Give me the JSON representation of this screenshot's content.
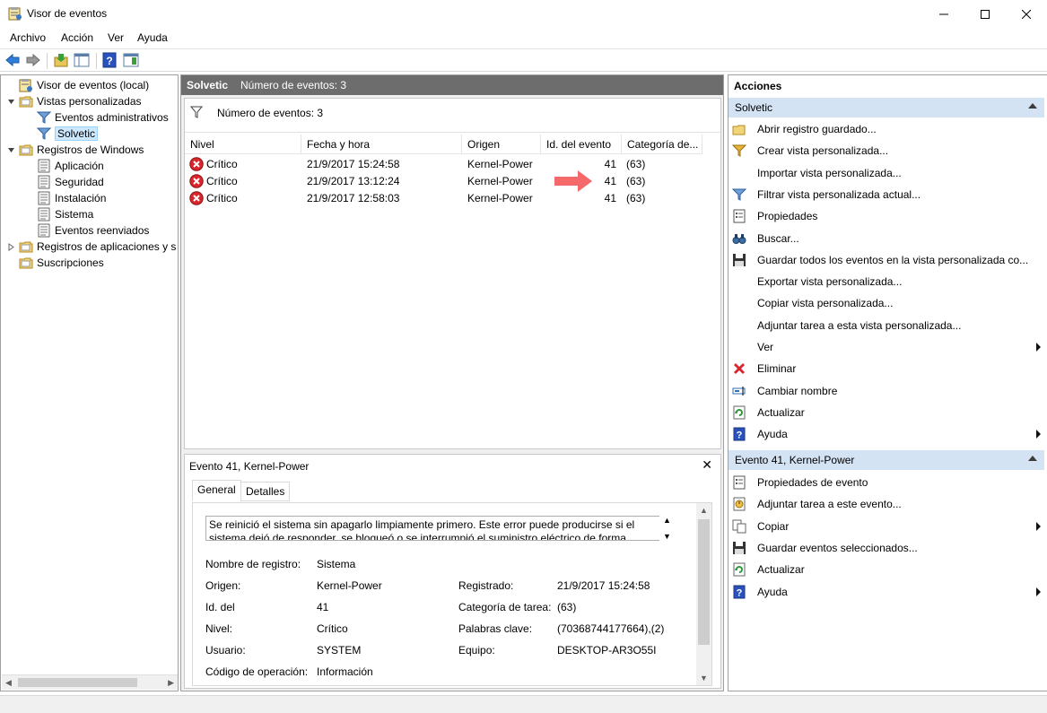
{
  "window": {
    "title": "Visor de eventos"
  },
  "menu": [
    "Archivo",
    "Acción",
    "Ver",
    "Ayuda"
  ],
  "toolbar": [
    "back-icon",
    "forward-icon",
    "open-folder-icon",
    "console-tree-icon",
    "help-icon",
    "action-pane-icon"
  ],
  "tree": [
    {
      "label": "Visor de eventos (local)",
      "icon": "event-viewer-icon",
      "level": 0,
      "twisty": ""
    },
    {
      "label": "Vistas personalizadas",
      "icon": "folder-icon",
      "level": 0,
      "twisty": "open"
    },
    {
      "label": "Eventos administrativos",
      "icon": "filter-icon",
      "level": 1,
      "twisty": ""
    },
    {
      "label": "Solvetic",
      "icon": "filter-icon",
      "level": 1,
      "twisty": "",
      "selected": true
    },
    {
      "label": "Registros de Windows",
      "icon": "folder-icon",
      "level": 0,
      "twisty": "open"
    },
    {
      "label": "Aplicación",
      "icon": "log-icon",
      "level": 1,
      "twisty": ""
    },
    {
      "label": "Seguridad",
      "icon": "log-icon",
      "level": 1,
      "twisty": ""
    },
    {
      "label": "Instalación",
      "icon": "log-icon",
      "level": 1,
      "twisty": ""
    },
    {
      "label": "Sistema",
      "icon": "log-icon",
      "level": 1,
      "twisty": ""
    },
    {
      "label": "Eventos reenviados",
      "icon": "log-icon",
      "level": 1,
      "twisty": ""
    },
    {
      "label": "Registros de aplicaciones y s",
      "icon": "folder-icon",
      "level": 0,
      "twisty": "closed"
    },
    {
      "label": "Suscripciones",
      "icon": "folder-icon",
      "level": 0,
      "twisty": ""
    }
  ],
  "center": {
    "view_name": "Solvetic",
    "event_count": "Número de eventos: 3",
    "filter_text": "Número de eventos: 3",
    "columns": [
      "Nivel",
      "Fecha y hora",
      "Origen",
      "Id. del evento",
      "Categoría de..."
    ],
    "events": [
      {
        "level": "Crítico",
        "datetime": "21/9/2017 15:24:58",
        "source": "Kernel-Power",
        "id": "41",
        "category": "(63)"
      },
      {
        "level": "Crítico",
        "datetime": "21/9/2017 13:12:24",
        "source": "Kernel-Power",
        "id": "41",
        "category": "(63)"
      },
      {
        "level": "Crítico",
        "datetime": "21/9/2017 12:58:03",
        "source": "Kernel-Power",
        "id": "41",
        "category": "(63)"
      }
    ]
  },
  "detail": {
    "title": "Evento 41, Kernel-Power",
    "tabs": [
      "General",
      "Detalles"
    ],
    "description_line1": "Se reinició el sistema sin apagarlo limpiamente primero. Este error puede producirse si el",
    "description_line2": "sistema dejó de responder, se bloqueó o se interrumpió el suministro eléctrico de forma",
    "fields": {
      "log_name_label": "Nombre de registro:",
      "log_name": "Sistema",
      "source_label": "Origen:",
      "source": "Kernel-Power",
      "logged_label": "Registrado:",
      "logged": "21/9/2017 15:24:58",
      "id_label": "Id. del",
      "id": "41",
      "task_label": "Categoría de tarea:",
      "task": "(63)",
      "level_label": "Nivel:",
      "level": "Crítico",
      "keywords_label": "Palabras clave:",
      "keywords": "(70368744177664),(2)",
      "user_label": "Usuario:",
      "user": "SYSTEM",
      "computer_label": "Equipo:",
      "computer": "DESKTOP-AR3O55I",
      "opcode_label": "Código de operación:",
      "opcode": "Información"
    }
  },
  "actions": {
    "title": "Acciones",
    "section1": "Solvetic",
    "items1": [
      {
        "label": "Abrir registro guardado...",
        "icon": "open-log-icon"
      },
      {
        "label": "Crear vista personalizada...",
        "icon": "create-view-icon"
      },
      {
        "label": "Importar vista personalizada...",
        "icon": ""
      },
      {
        "label": "Filtrar vista personalizada actual...",
        "icon": "filter-icon"
      },
      {
        "label": "Propiedades",
        "icon": "properties-icon"
      },
      {
        "label": "Buscar...",
        "icon": "binoculars-icon"
      },
      {
        "label": "Guardar todos los eventos en la vista personalizada co...",
        "icon": "save-icon"
      },
      {
        "label": "Exportar vista personalizada...",
        "icon": ""
      },
      {
        "label": "Copiar vista personalizada...",
        "icon": ""
      },
      {
        "label": "Adjuntar tarea a esta vista personalizada...",
        "icon": ""
      },
      {
        "label": "Ver",
        "icon": "",
        "submenu": true
      },
      {
        "label": "Eliminar",
        "icon": "delete-icon"
      },
      {
        "label": "Cambiar nombre",
        "icon": "rename-icon"
      },
      {
        "label": "Actualizar",
        "icon": "refresh-icon"
      },
      {
        "label": "Ayuda",
        "icon": "help-icon",
        "submenu": true
      }
    ],
    "section2": "Evento 41, Kernel-Power",
    "items2": [
      {
        "label": "Propiedades de evento",
        "icon": "properties-icon"
      },
      {
        "label": "Adjuntar tarea a este evento...",
        "icon": "attach-task-icon"
      },
      {
        "label": "Copiar",
        "icon": "copy-icon",
        "submenu": true
      },
      {
        "label": "Guardar eventos seleccionados...",
        "icon": "save-icon"
      },
      {
        "label": "Actualizar",
        "icon": "refresh-icon"
      },
      {
        "label": "Ayuda",
        "icon": "help-icon",
        "submenu": true
      }
    ]
  },
  "colors": {
    "accent_section": "#d4e3f4",
    "center_header": "#6d6d6d",
    "error_red": "#d9262c",
    "arrow": "#f5696b",
    "selection": "#cce8ff"
  }
}
